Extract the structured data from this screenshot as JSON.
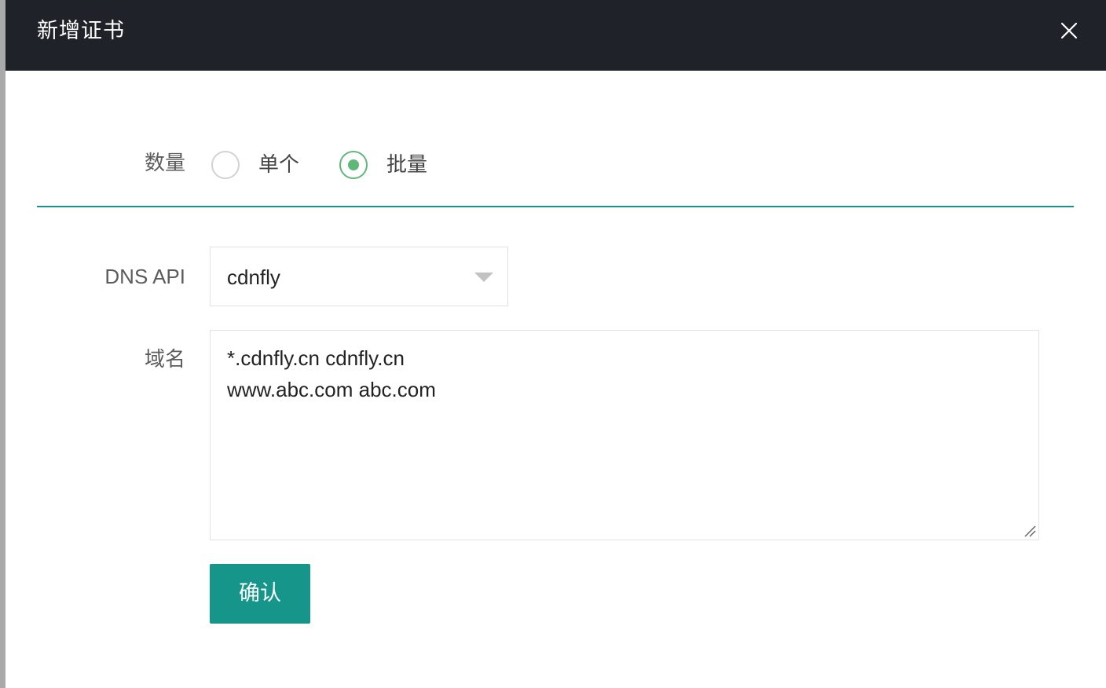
{
  "dialog": {
    "title": "新增证书"
  },
  "form": {
    "quantity": {
      "label": "数量",
      "options": [
        {
          "label": "单个",
          "selected": false
        },
        {
          "label": "批量",
          "selected": true
        }
      ]
    },
    "dns_api": {
      "label": "DNS API",
      "selected_value": "cdnfly"
    },
    "domains": {
      "label": "域名",
      "lines": [
        "*.cdnfly.cn cdnfly.cn",
        "www.abc.com abc.com"
      ]
    },
    "submit_label": "确认"
  },
  "colors": {
    "header_bg": "#20222a",
    "accent": "#16968a",
    "radio_checked": "#5fb878",
    "divider": "#17958a"
  },
  "icons": {
    "close": "close-icon",
    "dropdown": "caret-down-icon",
    "resize": "resize-handle-icon"
  }
}
